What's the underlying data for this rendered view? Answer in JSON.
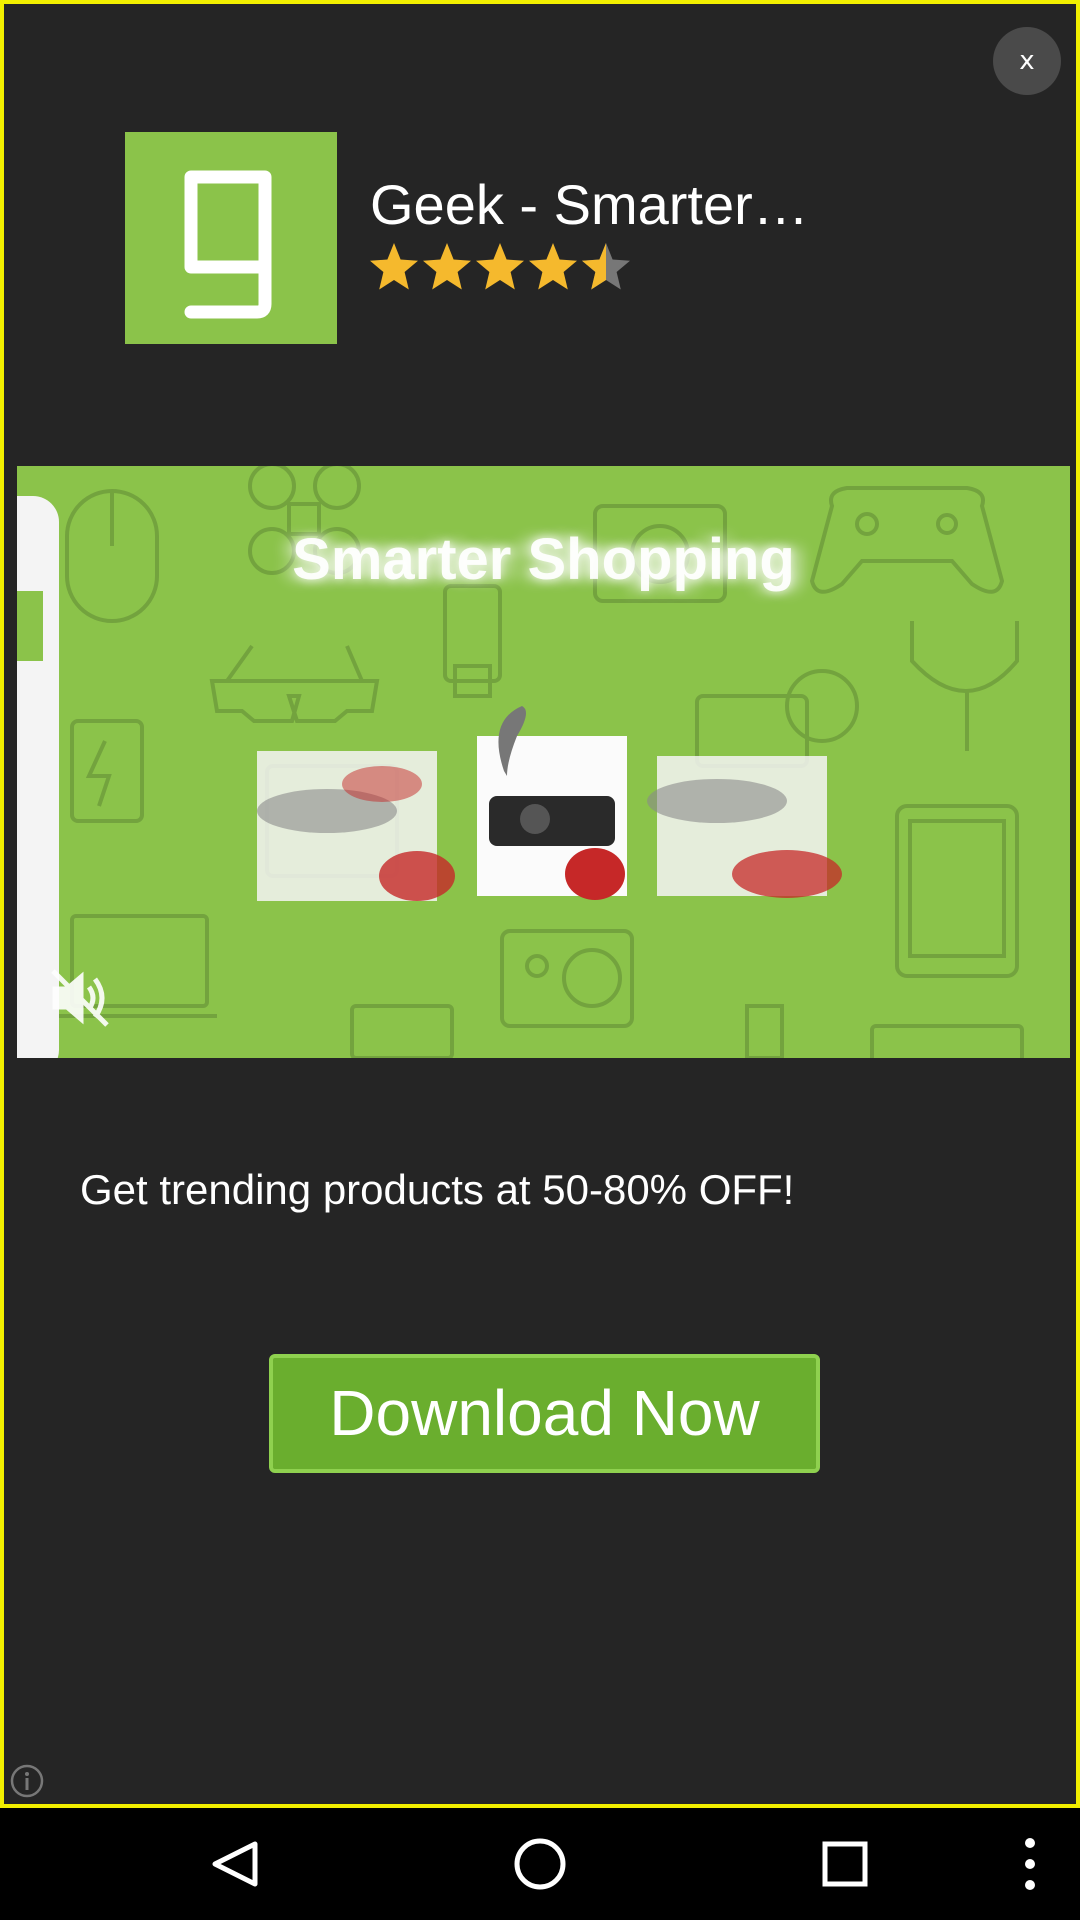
{
  "ad": {
    "close_label": "x",
    "app_name": "Geek - Smarter…",
    "rating_stars": 4.5,
    "rating_max": 5,
    "banner_headline": "Smarter Shopping",
    "promo_text": "Get trending products at 50-80% OFF!",
    "cta_label": "Download Now"
  },
  "colors": {
    "ad_background": "#252525",
    "highlight_border": "#f2ef00",
    "brand_green": "#8bc34a",
    "cta_green": "#6aae2e",
    "star": "#f5b92d"
  },
  "navbar": {
    "icons": [
      "back-icon",
      "home-icon",
      "recents-icon",
      "menu-icon"
    ]
  }
}
